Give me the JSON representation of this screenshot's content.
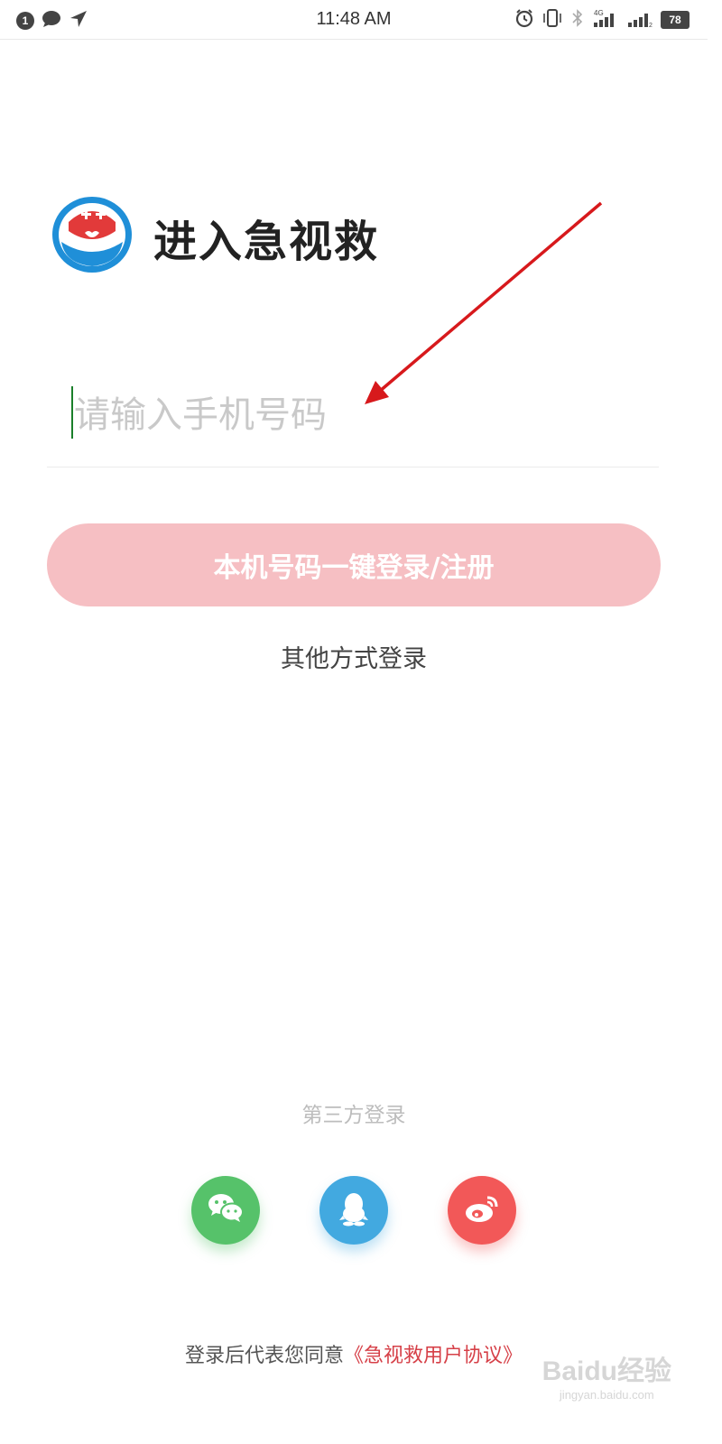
{
  "status_bar": {
    "notification_count": "1",
    "time": "11:48 AM",
    "network": "4G",
    "sim2": "2",
    "battery": "78"
  },
  "header": {
    "title": "进入急视救"
  },
  "phone": {
    "placeholder": "请输入手机号码",
    "value": ""
  },
  "login_button": {
    "label": "本机号码一键登录/注册"
  },
  "other_login": {
    "label": "其他方式登录"
  },
  "third_party": {
    "label": "第三方登录",
    "providers": [
      "wechat-icon",
      "qq-icon",
      "weibo-icon"
    ]
  },
  "agreement": {
    "prefix": "登录后代表您同意",
    "link": "《急视救用户协议》"
  },
  "watermark": {
    "main": "Baidu经验",
    "sub": "jingyan.baidu.com"
  },
  "colors": {
    "button_bg": "#f6bfc3",
    "link": "#d64048",
    "wechat": "#56c26a",
    "qq": "#42a9e0",
    "weibo": "#f25858",
    "arrow": "#d7191c"
  }
}
